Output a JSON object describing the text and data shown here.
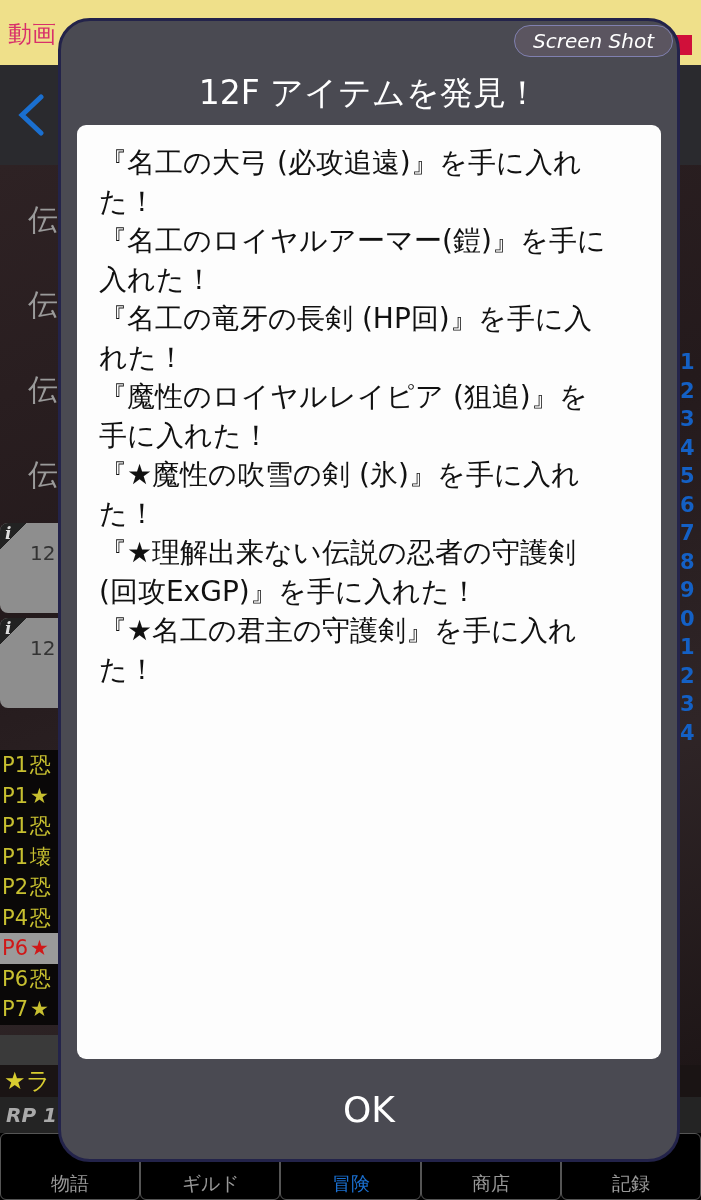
{
  "ad_banner": {
    "text": "動画"
  },
  "side_labels": [
    "伝",
    "伝",
    "伝",
    "伝"
  ],
  "cards": [
    {
      "info": "i",
      "number": "12"
    },
    {
      "info": "i",
      "number": "12"
    }
  ],
  "item_log": [
    {
      "page": "P1",
      "mark": "恐",
      "selected": false
    },
    {
      "page": "P1",
      "mark": "★",
      "selected": false
    },
    {
      "page": "P1",
      "mark": "恐",
      "selected": false
    },
    {
      "page": "P1",
      "mark": "壊",
      "selected": false
    },
    {
      "page": "P2",
      "mark": "恐",
      "selected": false
    },
    {
      "page": "P4",
      "mark": "恐",
      "selected": false
    },
    {
      "page": "P6",
      "mark": "★",
      "selected": true
    },
    {
      "page": "P6",
      "mark": "恐",
      "selected": false
    },
    {
      "page": "P7",
      "mark": "★",
      "selected": false
    }
  ],
  "index_numbers": [
    "1",
    "2",
    "3",
    "4",
    "5",
    "6",
    "7",
    "8",
    "9",
    "0",
    "1",
    "2",
    "3",
    "4"
  ],
  "status_bar": {
    "ticket": "★ラ",
    "rp": "RP 1"
  },
  "tabs": [
    {
      "label": "物語",
      "selected": false
    },
    {
      "label": "ギルド",
      "selected": false
    },
    {
      "label": "冒険",
      "selected": true
    },
    {
      "label": "商店",
      "selected": false
    },
    {
      "label": "記録",
      "selected": false
    }
  ],
  "dialog": {
    "screenshot_button": "Screen Shot",
    "title": "12F アイテムを発見！",
    "messages": [
      "『名工の大弓 (必攻追遠)』を手に入れた！",
      "『名工のロイヤルアーマー(鎧)』を手に入れた！",
      "『名工の竜牙の長剣 (HP回)』を手に入れた！",
      "『魔性のロイヤルレイピア (狙追)』を手に入れた！",
      "『★魔性の吹雪の剣 (氷)』を手に入れた！",
      "『★理解出来ない伝説の忍者の守護剣 (回攻ExGP)』を手に入れた！",
      "『★名工の君主の守護剣』を手に入れた！"
    ],
    "button": "OK"
  }
}
